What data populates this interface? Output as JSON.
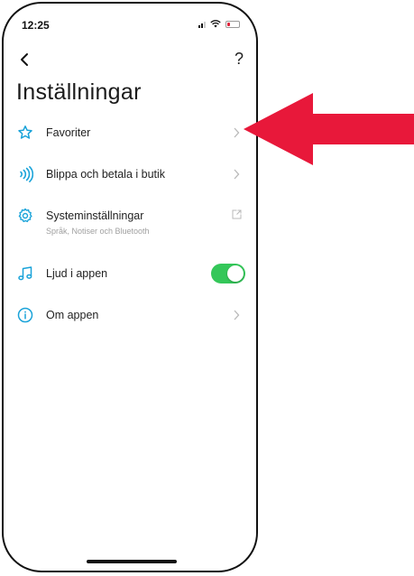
{
  "status_bar": {
    "time": "12:25",
    "icons": [
      "signal-icon",
      "wifi-icon",
      "battery-icon"
    ]
  },
  "nav": {
    "back_icon": "chevron-left-icon",
    "help_label": "?"
  },
  "page": {
    "title": "Inställningar"
  },
  "settings": {
    "items": [
      {
        "label": "Favoriter",
        "icon": "star-icon",
        "trailing": "chevron-right-icon"
      },
      {
        "label": "Blippa och betala i butik",
        "icon": "contactless-icon",
        "trailing": "chevron-right-icon"
      },
      {
        "label": "Systeminställningar",
        "subtitle": "Språk, Notiser och Bluetooth",
        "icon": "gear-icon",
        "trailing": "external-link-icon"
      },
      {
        "label": "Ljud i appen",
        "icon": "music-note-icon",
        "trailing": "toggle",
        "toggle_on": true
      },
      {
        "label": "Om appen",
        "icon": "info-icon",
        "trailing": "chevron-right-icon"
      }
    ]
  },
  "colors": {
    "accent": "#1aa3d9",
    "toggle_on": "#34c759",
    "annotation_arrow": "#e8183a",
    "text": "#222222",
    "subtext": "#a0a0a0"
  }
}
